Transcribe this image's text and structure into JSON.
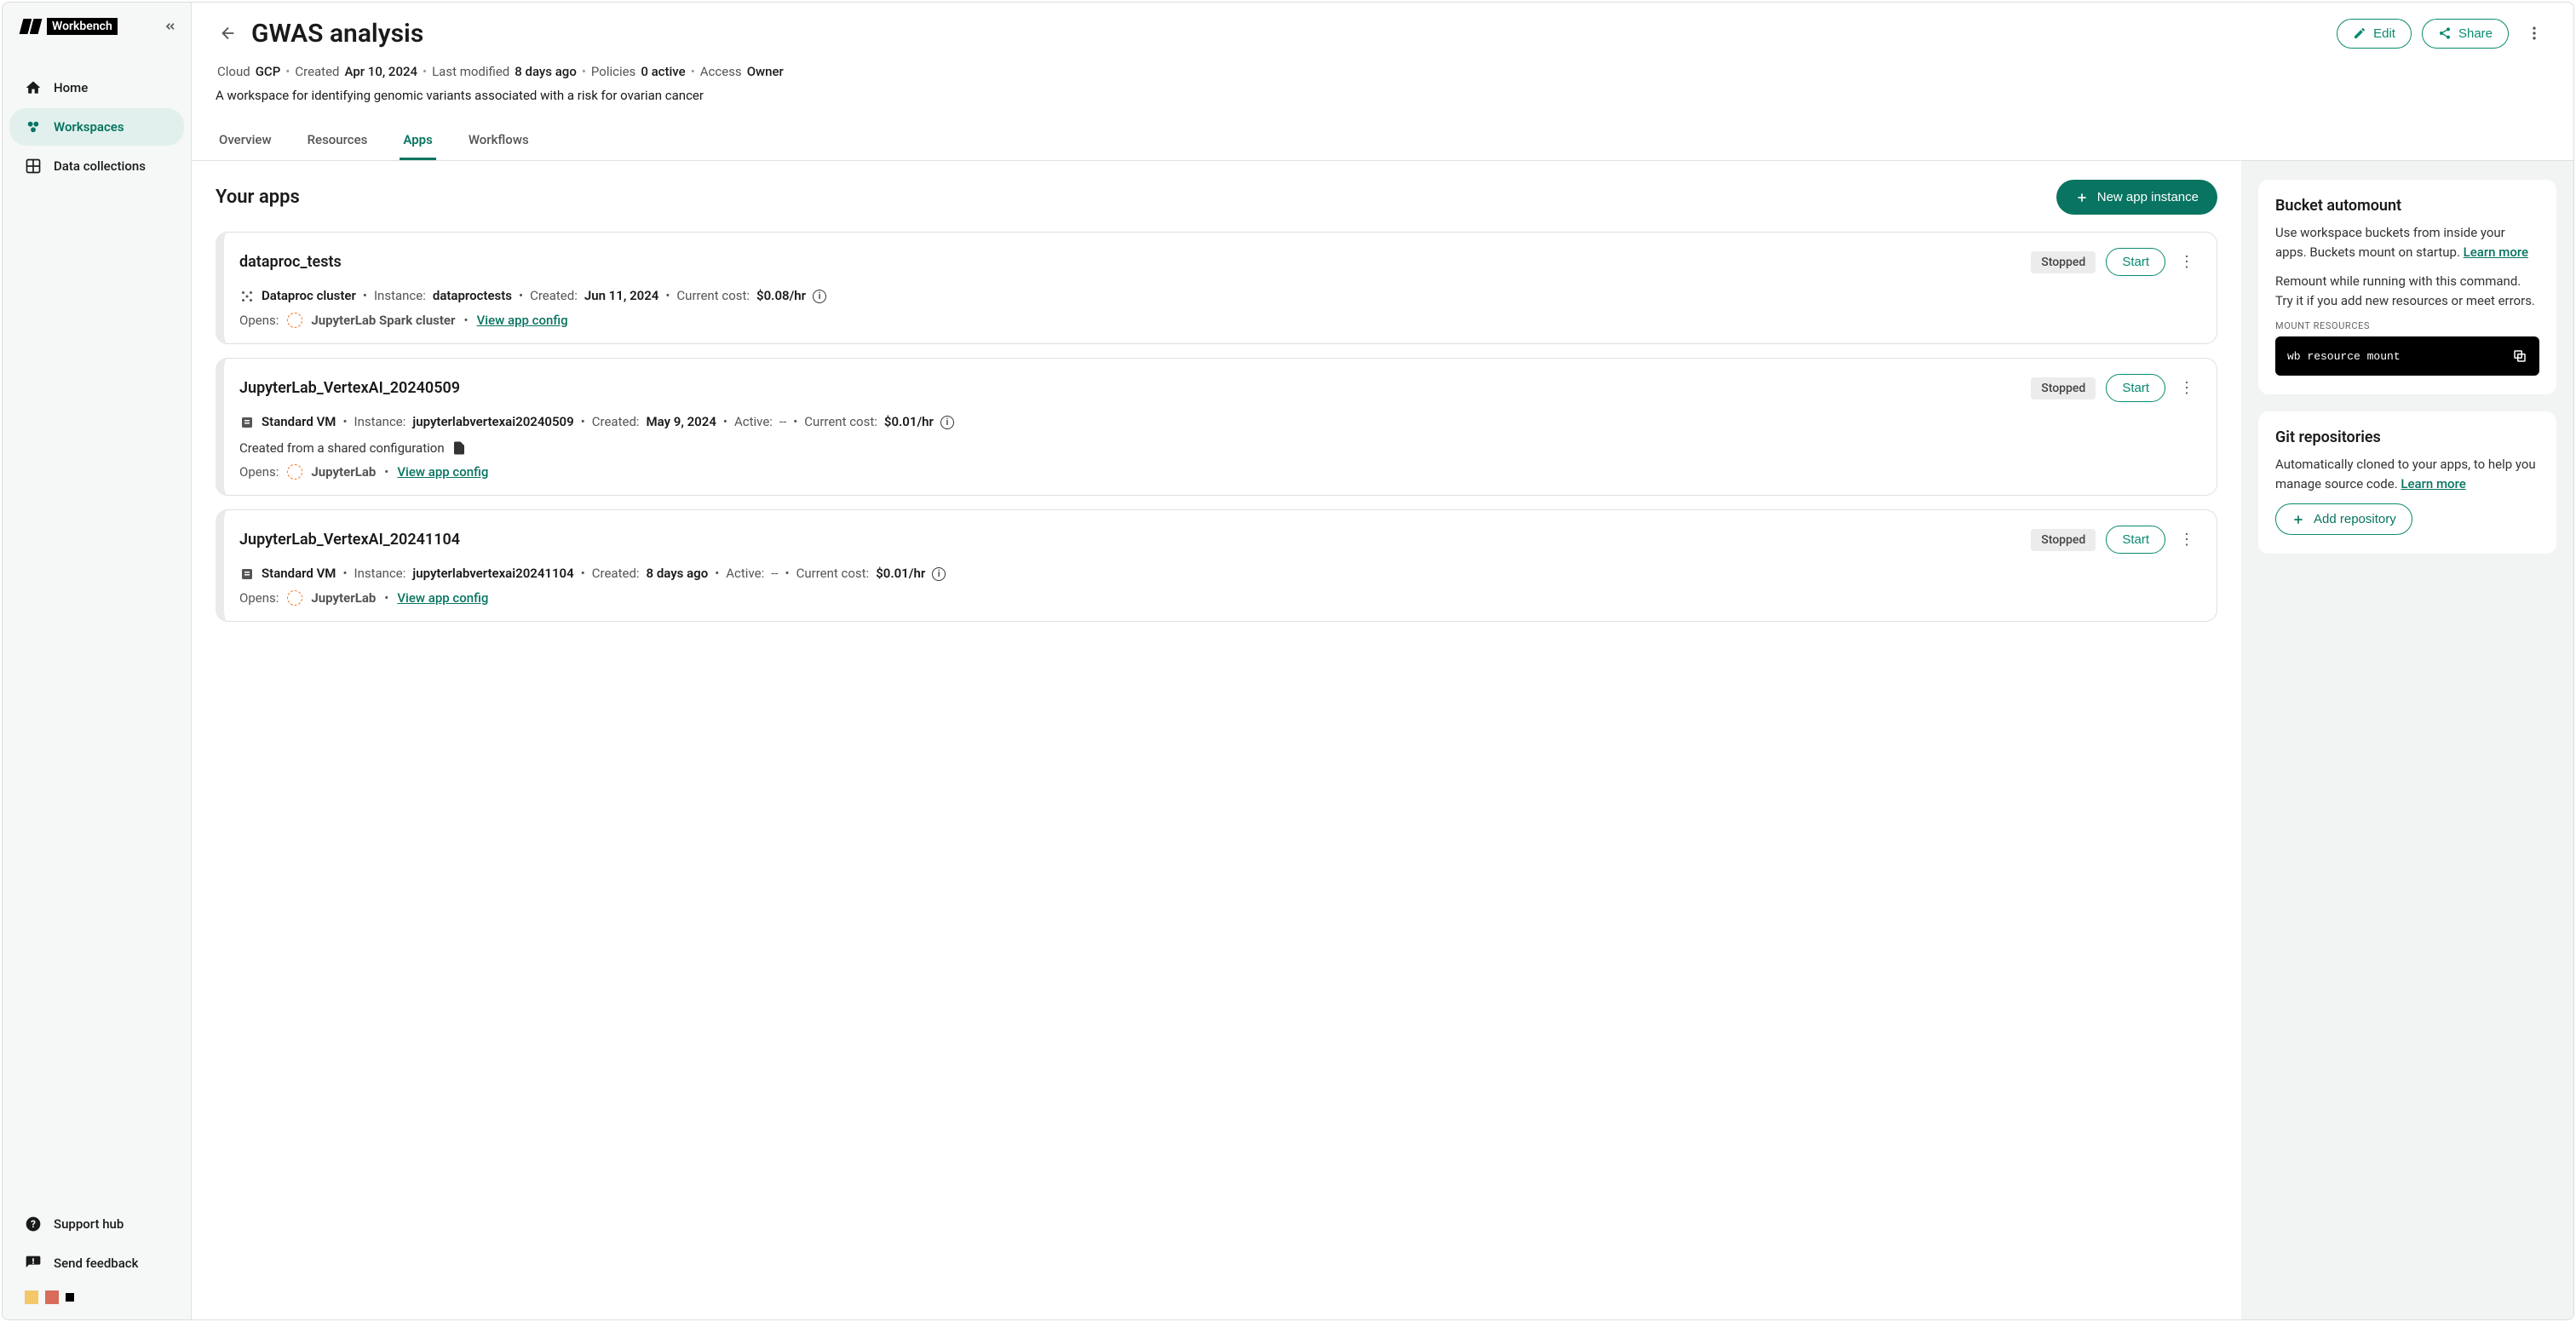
{
  "brand": {
    "name": "Workbench"
  },
  "sidebar": {
    "items": [
      {
        "label": "Home"
      },
      {
        "label": "Workspaces"
      },
      {
        "label": "Data collections"
      }
    ],
    "bottom": [
      {
        "label": "Support hub"
      },
      {
        "label": "Send feedback"
      }
    ]
  },
  "page": {
    "title": "GWAS analysis",
    "actions": {
      "edit": "Edit",
      "share": "Share"
    },
    "meta": {
      "cloud_label": "Cloud",
      "cloud_value": "GCP",
      "created_label": "Created",
      "created_value": "Apr 10, 2024",
      "modified_label": "Last modified",
      "modified_value": "8 days ago",
      "policies_label": "Policies",
      "policies_value": "0 active",
      "access_label": "Access",
      "access_value": "Owner"
    },
    "description": "A workspace for identifying genomic variants associated with a risk for ovarian cancer",
    "tabs": [
      "Overview",
      "Resources",
      "Apps",
      "Workflows"
    ],
    "active_tab": "Apps"
  },
  "apps": {
    "section_title": "Your apps",
    "new_button": "New app instance",
    "start_label": "Start",
    "opens_label": "Opens:",
    "instance_label": "Instance:",
    "created_label": "Created:",
    "active_label": "Active:",
    "current_cost_label": "Current cost:",
    "view_config": "View app config",
    "list": [
      {
        "name": "dataproc_tests",
        "status": "Stopped",
        "type": "Dataproc cluster",
        "instance": "dataproctests",
        "created": "Jun 11, 2024",
        "cost": "$0.08/hr",
        "opens_app": "JupyterLab Spark cluster"
      },
      {
        "name": "JupyterLab_VertexAI_20240509",
        "status": "Stopped",
        "type": "Standard VM",
        "instance": "jupyterlabvertexai20240509",
        "created": "May 9, 2024",
        "active": "--",
        "cost": "$0.01/hr",
        "note": "Created from a shared configuration",
        "opens_app": "JupyterLab"
      },
      {
        "name": "JupyterLab_VertexAI_20241104",
        "status": "Stopped",
        "type": "Standard VM",
        "instance": "jupyterlabvertexai20241104",
        "created": "8 days ago",
        "active": "--",
        "cost": "$0.01/hr",
        "opens_app": "JupyterLab"
      }
    ]
  },
  "automount": {
    "title": "Bucket automount",
    "text1a": "Use workspace buckets from inside your apps. Buckets mount on startup. ",
    "learn_more": "Learn more",
    "text2": "Remount while running with this command. Try it if you add new resources or meet errors.",
    "code_label": "MOUNT RESOURCES",
    "code": "wb resource mount"
  },
  "gitrepos": {
    "title": "Git repositories",
    "text": "Automatically cloned to your apps, to help you manage source code. ",
    "learn_more": "Learn more",
    "add_button": "Add repository"
  }
}
